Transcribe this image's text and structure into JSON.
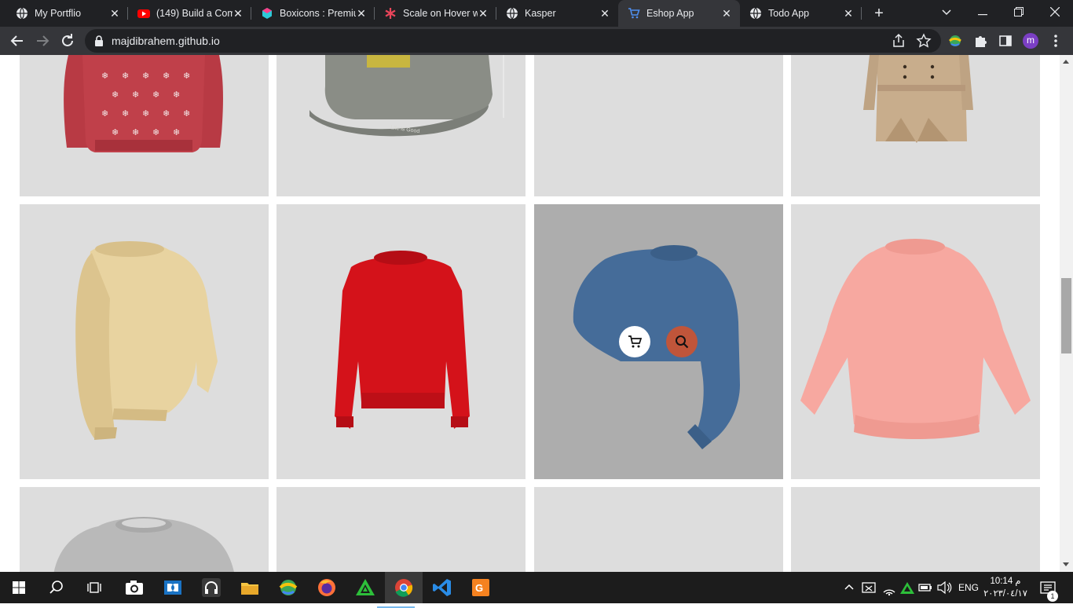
{
  "browser": {
    "tabs": [
      {
        "title": "My Portflio",
        "icon": "globe-icon"
      },
      {
        "title": "(149) Build a Com",
        "icon": "youtube-icon"
      },
      {
        "title": "Boxicons : Premiu",
        "icon": "boxicons-icon"
      },
      {
        "title": "Scale on Hover w",
        "icon": "asterisk-icon"
      },
      {
        "title": "Kasper",
        "icon": "globe-icon"
      },
      {
        "title": "Eshop App",
        "icon": "cart-icon"
      },
      {
        "title": "Todo App",
        "icon": "globe-icon"
      }
    ],
    "active_tab": "Eshop App",
    "url": "majdibrahem.github.io",
    "profile_initial": "m"
  },
  "products": {
    "row1": [
      {
        "name": "christmas-sweater"
      },
      {
        "name": "baseball-cap",
        "print": "Life is Good"
      },
      {
        "name": "empty"
      },
      {
        "name": "trench-coat"
      }
    ],
    "row2": [
      {
        "name": "beige-sweater"
      },
      {
        "name": "red-sweatshirt"
      },
      {
        "name": "blue-crop-sweater",
        "hover": true
      },
      {
        "name": "pink-sweatshirt"
      }
    ],
    "row3": [
      {
        "name": "grey-tshirt"
      },
      {
        "name": "empty"
      },
      {
        "name": "empty"
      },
      {
        "name": "empty"
      }
    ],
    "hover_actions": [
      {
        "icon": "cart-icon"
      },
      {
        "icon": "search-icon"
      }
    ]
  },
  "taskbar": {
    "language": "ENG",
    "time": "10:14 م",
    "date": "٢٠٢٣/٠٤/١٧",
    "notification_count": "1"
  }
}
